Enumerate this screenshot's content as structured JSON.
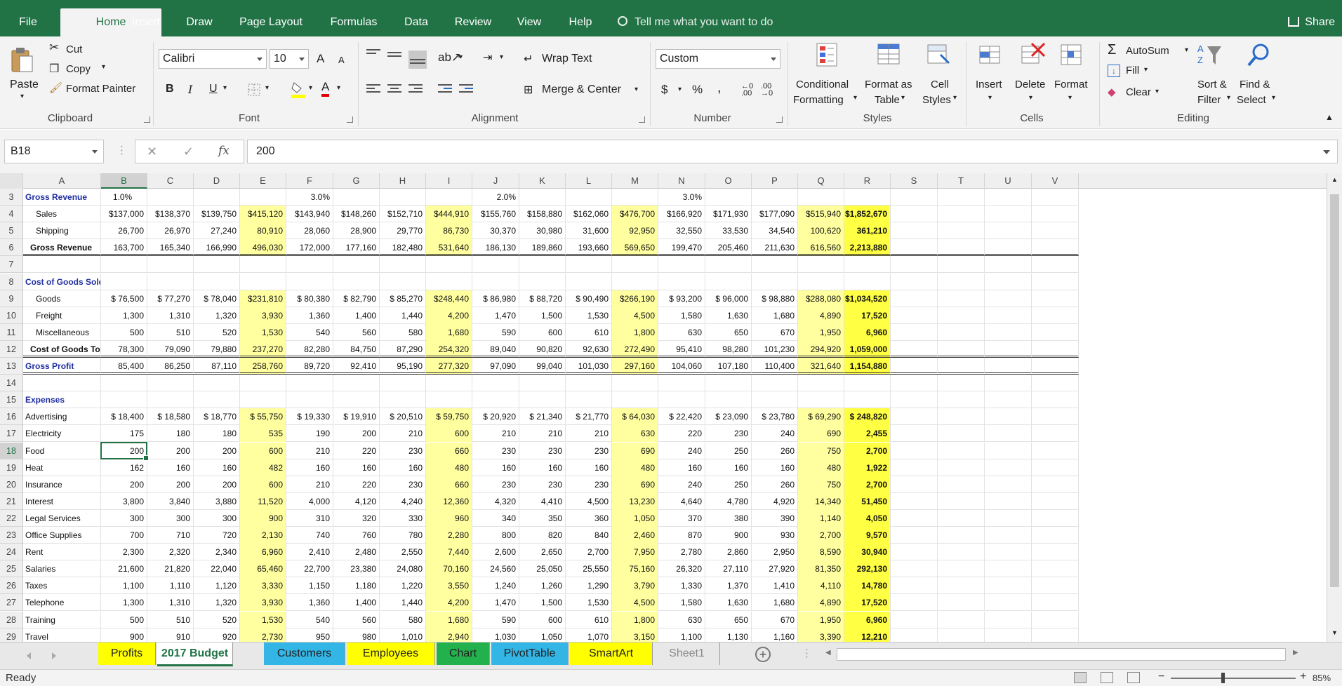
{
  "ribbon_tabs": [
    "File",
    "Home",
    "Insert",
    "Draw",
    "Page Layout",
    "Formulas",
    "Data",
    "Review",
    "View",
    "Help"
  ],
  "active_tab": "Home",
  "tell_me": "Tell me what you want to do",
  "share": "Share",
  "clipboard": {
    "paste": "Paste",
    "cut": "Cut",
    "copy": "Copy",
    "format_painter": "Format Painter",
    "label": "Clipboard"
  },
  "font": {
    "name": "Calibri",
    "size": "10",
    "grow": "A",
    "shrink": "A",
    "bold": "B",
    "italic": "I",
    "underline": "U",
    "font_color": "A",
    "label": "Font"
  },
  "alignment": {
    "wrap_text": "Wrap Text",
    "merge_center": "Merge & Center",
    "label": "Alignment"
  },
  "number": {
    "format": "Custom",
    "currency": "$",
    "percent": "%",
    "comma": ",",
    "label": "Number"
  },
  "styles": {
    "conditional_formatting": [
      "Conditional",
      "Formatting"
    ],
    "format_as_table": [
      "Format as",
      "Table"
    ],
    "cell_styles": [
      "Cell",
      "Styles"
    ],
    "label": "Styles"
  },
  "cells": {
    "insert": "Insert",
    "delete": "Delete",
    "format": "Format",
    "label": "Cells"
  },
  "editing": {
    "autosum": "AutoSum",
    "fill": "Fill",
    "clear": "Clear",
    "sort_filter": [
      "Sort &",
      "Filter"
    ],
    "find_select": [
      "Find &",
      "Select"
    ],
    "label": "Editing"
  },
  "formula_bar": {
    "name_box": "B18",
    "fx": "fx",
    "value": "200"
  },
  "columns": [
    "A",
    "B",
    "C",
    "D",
    "E",
    "F",
    "G",
    "H",
    "I",
    "J",
    "K",
    "L",
    "M",
    "N",
    "O",
    "P",
    "Q",
    "R",
    "S",
    "T",
    "U",
    "V"
  ],
  "selected_column": "B",
  "selected_row": "18",
  "rows": [
    {
      "n": "3",
      "cells": [
        "Gross Revenue",
        "1.0%",
        "",
        "",
        "",
        "3.0%",
        "",
        "",
        "",
        "2.0%",
        "",
        "",
        "",
        "3.0%",
        "",
        "",
        "",
        ""
      ]
    },
    {
      "n": "4",
      "cells": [
        "Sales",
        "$137,000",
        "$138,370",
        "$139,750",
        "$415,120",
        "$143,940",
        "$148,260",
        "$152,710",
        "$444,910",
        "$155,760",
        "$158,880",
        "$162,060",
        "$476,700",
        "$166,920",
        "$171,930",
        "$177,090",
        "$515,940",
        "$1,852,670"
      ]
    },
    {
      "n": "5",
      "cells": [
        "Shipping",
        "26,700",
        "26,970",
        "27,240",
        "80,910",
        "28,060",
        "28,900",
        "29,770",
        "86,730",
        "30,370",
        "30,980",
        "31,600",
        "92,950",
        "32,550",
        "33,530",
        "34,540",
        "100,620",
        "361,210"
      ]
    },
    {
      "n": "6",
      "cells": [
        "Gross Revenue",
        "163,700",
        "165,340",
        "166,990",
        "496,030",
        "172,000",
        "177,160",
        "182,480",
        "531,640",
        "186,130",
        "189,860",
        "193,660",
        "569,650",
        "199,470",
        "205,460",
        "211,630",
        "616,560",
        "2,213,880"
      ]
    },
    {
      "n": "7",
      "cells": [
        "",
        "",
        "",
        "",
        "",
        "",
        "",
        "",
        "",
        "",
        "",
        "",
        "",
        "",
        "",
        "",
        "",
        ""
      ]
    },
    {
      "n": "8",
      "cells": [
        "Cost of Goods Sold",
        "",
        "",
        "",
        "",
        "",
        "",
        "",
        "",
        "",
        "",
        "",
        "",
        "",
        "",
        "",
        "",
        ""
      ]
    },
    {
      "n": "9",
      "cells": [
        "Goods",
        "$ 76,500",
        "$ 77,270",
        "$ 78,040",
        "$231,810",
        "$ 80,380",
        "$ 82,790",
        "$ 85,270",
        "$248,440",
        "$ 86,980",
        "$ 88,720",
        "$ 90,490",
        "$266,190",
        "$ 93,200",
        "$ 96,000",
        "$ 98,880",
        "$288,080",
        "$1,034,520"
      ]
    },
    {
      "n": "10",
      "cells": [
        "Freight",
        "1,300",
        "1,310",
        "1,320",
        "3,930",
        "1,360",
        "1,400",
        "1,440",
        "4,200",
        "1,470",
        "1,500",
        "1,530",
        "4,500",
        "1,580",
        "1,630",
        "1,680",
        "4,890",
        "17,520"
      ]
    },
    {
      "n": "11",
      "cells": [
        "Miscellaneous",
        "500",
        "510",
        "520",
        "1,530",
        "540",
        "560",
        "580",
        "1,680",
        "590",
        "600",
        "610",
        "1,800",
        "630",
        "650",
        "670",
        "1,950",
        "6,960"
      ]
    },
    {
      "n": "12",
      "cells": [
        "Cost of Goods Total",
        "78,300",
        "79,090",
        "79,880",
        "237,270",
        "82,280",
        "84,750",
        "87,290",
        "254,320",
        "89,040",
        "90,820",
        "92,630",
        "272,490",
        "95,410",
        "98,280",
        "101,230",
        "294,920",
        "1,059,000"
      ]
    },
    {
      "n": "13",
      "cells": [
        "Gross Profit",
        "85,400",
        "86,250",
        "87,110",
        "258,760",
        "89,720",
        "92,410",
        "95,190",
        "277,320",
        "97,090",
        "99,040",
        "101,030",
        "297,160",
        "104,060",
        "107,180",
        "110,400",
        "321,640",
        "1,154,880"
      ]
    },
    {
      "n": "14",
      "cells": [
        "",
        "",
        "",
        "",
        "",
        "",
        "",
        "",
        "",
        "",
        "",
        "",
        "",
        "",
        "",
        "",
        "",
        ""
      ]
    },
    {
      "n": "15",
      "cells": [
        "Expenses",
        "",
        "",
        "",
        "",
        "",
        "",
        "",
        "",
        "",
        "",
        "",
        "",
        "",
        "",
        "",
        "",
        ""
      ]
    },
    {
      "n": "16",
      "cells": [
        "Advertising",
        "$ 18,400",
        "$ 18,580",
        "$ 18,770",
        "$ 55,750",
        "$ 19,330",
        "$ 19,910",
        "$ 20,510",
        "$ 59,750",
        "$ 20,920",
        "$ 21,340",
        "$ 21,770",
        "$ 64,030",
        "$ 22,420",
        "$ 23,090",
        "$ 23,780",
        "$ 69,290",
        "$ 248,820"
      ]
    },
    {
      "n": "17",
      "cells": [
        "Electricity",
        "175",
        "180",
        "180",
        "535",
        "190",
        "200",
        "210",
        "600",
        "210",
        "210",
        "210",
        "630",
        "220",
        "230",
        "240",
        "690",
        "2,455"
      ]
    },
    {
      "n": "18",
      "cells": [
        "Food",
        "200",
        "200",
        "200",
        "600",
        "210",
        "220",
        "230",
        "660",
        "230",
        "230",
        "230",
        "690",
        "240",
        "250",
        "260",
        "750",
        "2,700"
      ]
    },
    {
      "n": "19",
      "cells": [
        "Heat",
        "162",
        "160",
        "160",
        "482",
        "160",
        "160",
        "160",
        "480",
        "160",
        "160",
        "160",
        "480",
        "160",
        "160",
        "160",
        "480",
        "1,922"
      ]
    },
    {
      "n": "20",
      "cells": [
        "Insurance",
        "200",
        "200",
        "200",
        "600",
        "210",
        "220",
        "230",
        "660",
        "230",
        "230",
        "230",
        "690",
        "240",
        "250",
        "260",
        "750",
        "2,700"
      ]
    },
    {
      "n": "21",
      "cells": [
        "Interest",
        "3,800",
        "3,840",
        "3,880",
        "11,520",
        "4,000",
        "4,120",
        "4,240",
        "12,360",
        "4,320",
        "4,410",
        "4,500",
        "13,230",
        "4,640",
        "4,780",
        "4,920",
        "14,340",
        "51,450"
      ]
    },
    {
      "n": "22",
      "cells": [
        "Legal Services",
        "300",
        "300",
        "300",
        "900",
        "310",
        "320",
        "330",
        "960",
        "340",
        "350",
        "360",
        "1,050",
        "370",
        "380",
        "390",
        "1,140",
        "4,050"
      ]
    },
    {
      "n": "23",
      "cells": [
        "Office Supplies",
        "700",
        "710",
        "720",
        "2,130",
        "740",
        "760",
        "780",
        "2,280",
        "800",
        "820",
        "840",
        "2,460",
        "870",
        "900",
        "930",
        "2,700",
        "9,570"
      ]
    },
    {
      "n": "24",
      "cells": [
        "Rent",
        "2,300",
        "2,320",
        "2,340",
        "6,960",
        "2,410",
        "2,480",
        "2,550",
        "7,440",
        "2,600",
        "2,650",
        "2,700",
        "7,950",
        "2,780",
        "2,860",
        "2,950",
        "8,590",
        "30,940"
      ]
    },
    {
      "n": "25",
      "cells": [
        "Salaries",
        "21,600",
        "21,820",
        "22,040",
        "65,460",
        "22,700",
        "23,380",
        "24,080",
        "70,160",
        "24,560",
        "25,050",
        "25,550",
        "75,160",
        "26,320",
        "27,110",
        "27,920",
        "81,350",
        "292,130"
      ]
    },
    {
      "n": "26",
      "cells": [
        "Taxes",
        "1,100",
        "1,110",
        "1,120",
        "3,330",
        "1,150",
        "1,180",
        "1,220",
        "3,550",
        "1,240",
        "1,260",
        "1,290",
        "3,790",
        "1,330",
        "1,370",
        "1,410",
        "4,110",
        "14,780"
      ]
    },
    {
      "n": "27",
      "cells": [
        "Telephone",
        "1,300",
        "1,310",
        "1,320",
        "3,930",
        "1,360",
        "1,400",
        "1,440",
        "4,200",
        "1,470",
        "1,500",
        "1,530",
        "4,500",
        "1,580",
        "1,630",
        "1,680",
        "4,890",
        "17,520"
      ]
    },
    {
      "n": "28",
      "cells": [
        "Training",
        "500",
        "510",
        "520",
        "1,530",
        "540",
        "560",
        "580",
        "1,680",
        "590",
        "600",
        "610",
        "1,800",
        "630",
        "650",
        "670",
        "1,950",
        "6,960"
      ]
    },
    {
      "n": "29",
      "cells": [
        "Travel",
        "900",
        "910",
        "920",
        "2,730",
        "950",
        "980",
        "1,010",
        "2,940",
        "1,030",
        "1,050",
        "1,070",
        "3,150",
        "1,100",
        "1,130",
        "1,160",
        "3,390",
        "12,210"
      ]
    }
  ],
  "sheet_tabs": [
    {
      "name": "Profits",
      "color": "#ffff00"
    },
    {
      "name": "2017 Budget",
      "color": "#ffffff"
    },
    {
      "name": "Customers",
      "color": "#33b5e5"
    },
    {
      "name": "Employees",
      "color": "#ffff00"
    },
    {
      "name": "Chart",
      "color": "#22b14c"
    },
    {
      "name": "PivotTable",
      "color": "#33b5e5"
    },
    {
      "name": "SmartArt",
      "color": "#ffff00"
    },
    {
      "name": "Sheet1",
      "color": "#e8e8e8"
    }
  ],
  "active_sheet": "2017 Budget",
  "status": {
    "ready": "Ready",
    "zoom": "85%"
  },
  "colors": {
    "accent": "#217346",
    "quarter_fill": "#ffffa0",
    "total_fill": "#ffff44",
    "section_text": "#1f2fa0"
  }
}
